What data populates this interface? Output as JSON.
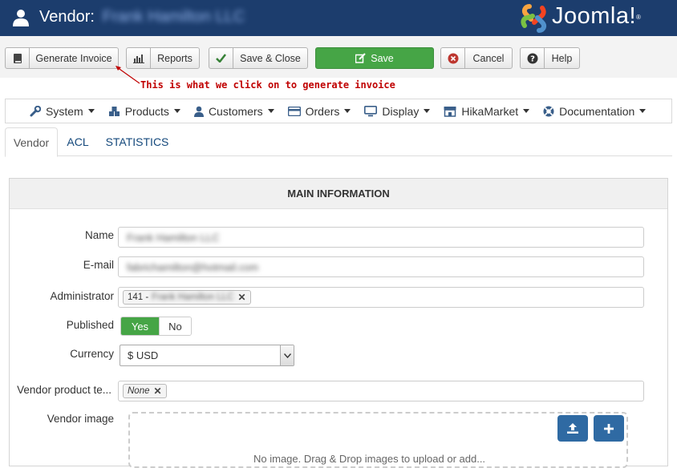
{
  "header": {
    "title_prefix": "Vendor:",
    "title_name": "Frank Hamilton LLC",
    "logo_text": "Joomla!",
    "logo_mark": "®"
  },
  "toolbar": {
    "generate_invoice": "Generate Invoice",
    "reports": "Reports",
    "save_close": "Save & Close",
    "save": "Save",
    "cancel": "Cancel",
    "help": "Help"
  },
  "annotation": "This is what we click on to generate invoice",
  "menu": [
    {
      "label": "System",
      "icon": "wrench-icon"
    },
    {
      "label": "Products",
      "icon": "cubes-icon"
    },
    {
      "label": "Customers",
      "icon": "user-icon"
    },
    {
      "label": "Orders",
      "icon": "credit-card-icon"
    },
    {
      "label": "Display",
      "icon": "monitor-icon"
    },
    {
      "label": "HikaMarket",
      "icon": "store-icon"
    },
    {
      "label": "Documentation",
      "icon": "life-ring-icon"
    }
  ],
  "tabs": [
    "Vendor",
    "ACL",
    "STATISTICS"
  ],
  "panel": {
    "title": "MAIN INFORMATION",
    "name_label": "Name",
    "name_value": "Frank Hamilton LLC",
    "email_label": "E-mail",
    "email_value": "fabrichamilton@hotmail.com",
    "admin_label": "Administrator",
    "admin_id": "141 -",
    "admin_name": "Frank Hamilton LLC",
    "published_label": "Published",
    "published_yes": "Yes",
    "published_no": "No",
    "currency_label": "Currency",
    "currency_value": "$ USD",
    "template_label": "Vendor product te...",
    "template_tag": "None",
    "image_label": "Vendor image",
    "dropzone_text": "No image. Drag & Drop images to upload or add..."
  },
  "colors": {
    "header_bg": "#1c3d6d",
    "save_green": "#46a546",
    "yes_green": "#46a546",
    "link_blue": "#15497c",
    "annotation_red": "#c00000",
    "upload_blue": "#2f6aa3"
  }
}
